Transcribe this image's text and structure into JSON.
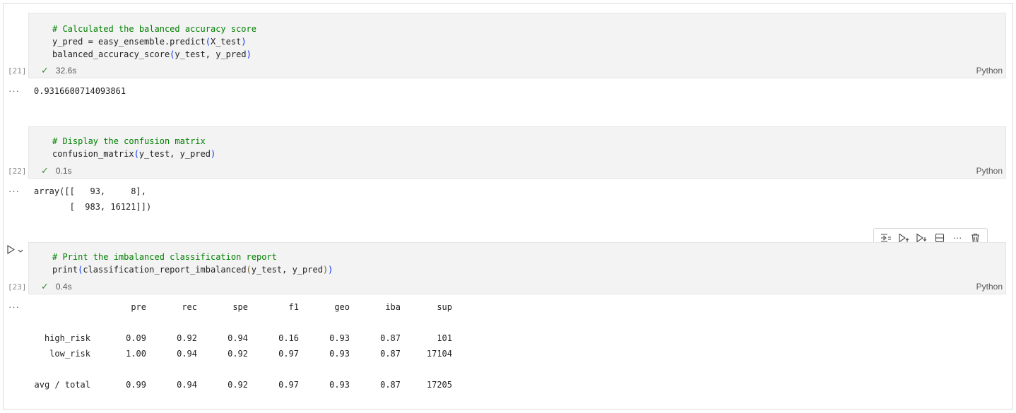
{
  "cells": [
    {
      "exec_no": "[21]",
      "code": {
        "comment": "# Calculated the balanced accuracy score",
        "line2": "y_pred = easy_ensemble.predict",
        "line2_args": "X_test",
        "line3": "balanced_accuracy_score",
        "line3_args": "y_test, y_pred"
      },
      "duration": "32.6s",
      "language": "Python",
      "output": "0.9316600714093861"
    },
    {
      "exec_no": "[22]",
      "code": {
        "comment": "# Display the confusion matrix",
        "line2": "confusion_matrix",
        "line2_args": "y_test, y_pred"
      },
      "duration": "0.1s",
      "language": "Python",
      "output_lines": [
        "array([[   93,     8],",
        "       [  983, 16121]])"
      ]
    },
    {
      "exec_no": "[23]",
      "code": {
        "comment": "# Print the imbalanced classification report",
        "line2": "print",
        "line2_inner": "classification_report_imbalanced",
        "line2_args": "y_test, y_pred"
      },
      "duration": "0.4s",
      "language": "Python",
      "report": {
        "headers": [
          "pre",
          "rec",
          "spe",
          "f1",
          "geo",
          "iba",
          "sup"
        ],
        "rows": [
          {
            "label": "high_risk",
            "values": [
              "0.09",
              "0.92",
              "0.94",
              "0.16",
              "0.93",
              "0.87",
              "101"
            ]
          },
          {
            "label": "low_risk",
            "values": [
              "1.00",
              "0.94",
              "0.92",
              "0.97",
              "0.93",
              "0.87",
              "17104"
            ]
          },
          {
            "label": "avg / total",
            "values": [
              "0.99",
              "0.94",
              "0.92",
              "0.97",
              "0.93",
              "0.87",
              "17205"
            ]
          }
        ]
      }
    }
  ],
  "output_marker": "···",
  "status_icon": "check-icon",
  "toolbar_icons": [
    "execute-above-icon",
    "run-above-icon",
    "run-below-icon",
    "split-cell-icon",
    "more-icon",
    "delete-icon"
  ]
}
